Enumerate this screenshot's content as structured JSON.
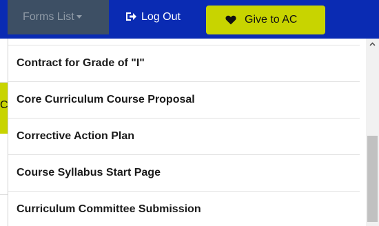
{
  "navbar": {
    "forms_label": "Forms List",
    "logout_label": "Log Out",
    "give_label": "Give to AC",
    "colors": {
      "bar": "#0a2bb3",
      "forms_bg": "#3d4f64",
      "give_bg": "#c8d400"
    }
  },
  "background": {
    "partial_letter": "C"
  },
  "dropdown": {
    "items": [
      {
        "label": "Contract for Grade of \"I\""
      },
      {
        "label": "Core Curriculum Course Proposal"
      },
      {
        "label": "Corrective Action Plan"
      },
      {
        "label": "Course Syllabus Start Page"
      },
      {
        "label": "Curriculum Committee Submission"
      }
    ]
  },
  "icons": {
    "logout": "logout-arrow-icon",
    "give": "heart-icon",
    "forms_caret": "caret-down-icon",
    "scroll_up": "chevron-up-icon"
  }
}
